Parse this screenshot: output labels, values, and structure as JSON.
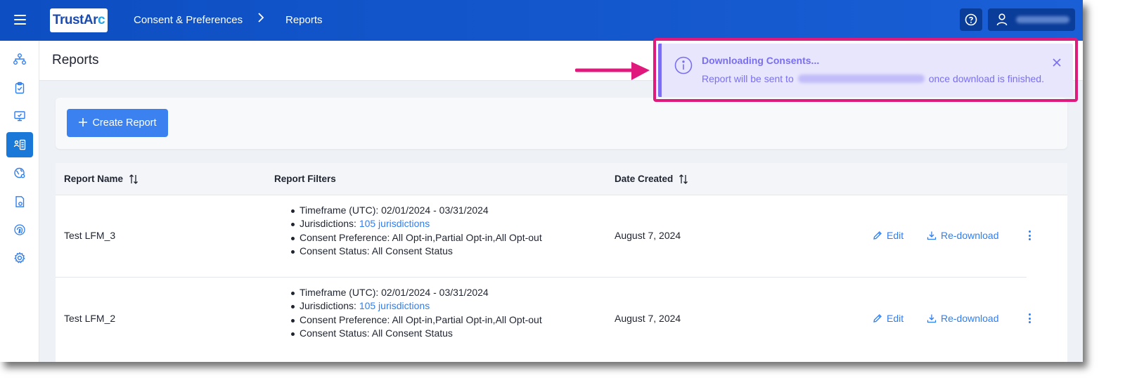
{
  "topbar": {
    "logo_main": "TrustAr",
    "logo_arc": "c",
    "breadcrumb": [
      "Consent & Preferences",
      "Reports"
    ]
  },
  "sidebar": {
    "items": [
      {
        "icon": "org-chart-icon",
        "active": false
      },
      {
        "icon": "clipboard-check-icon",
        "active": false
      },
      {
        "icon": "monitor-icon",
        "active": false
      },
      {
        "icon": "reports-icon",
        "active": true
      },
      {
        "icon": "globe-user-icon",
        "active": false
      },
      {
        "icon": "document-settings-icon",
        "active": false
      },
      {
        "icon": "fingerprint-icon",
        "active": false
      },
      {
        "icon": "gear-icon",
        "active": false
      }
    ]
  },
  "page": {
    "title": "Reports",
    "create_button": "Create Report"
  },
  "table": {
    "headers": {
      "name": "Report Name",
      "filters": "Report Filters",
      "date": "Date Created"
    },
    "rows": [
      {
        "name": "Test LFM_3",
        "filters": {
          "timeframe": "Timeframe (UTC): 02/01/2024 - 03/31/2024",
          "jurisdictions_label": "Jurisdictions: ",
          "jurisdictions_link": "105 jurisdictions",
          "preference": "Consent Preference: All Opt-in,Partial Opt-in,All Opt-out",
          "status": "Consent Status: All Consent Status"
        },
        "date": "August 7, 2024",
        "edit": "Edit",
        "redownload": "Re-download"
      },
      {
        "name": "Test LFM_2",
        "filters": {
          "timeframe": "Timeframe (UTC): 02/01/2024 - 03/31/2024",
          "jurisdictions_label": "Jurisdictions: ",
          "jurisdictions_link": "105 jurisdictions",
          "preference": "Consent Preference: All Opt-in,Partial Opt-in,All Opt-out",
          "status": "Consent Status: All Consent Status"
        },
        "date": "August 7, 2024",
        "edit": "Edit",
        "redownload": "Re-download"
      }
    ]
  },
  "toast": {
    "title": "Downloading Consents...",
    "message_prefix": "Report will be sent to",
    "message_suffix": "once download is finished."
  },
  "colors": {
    "topbar": "#1a5fd6",
    "accent": "#3b82f0",
    "toast_bg": "#e8e6fd",
    "toast_text": "#7a6ff0",
    "highlight": "#e0197d"
  }
}
